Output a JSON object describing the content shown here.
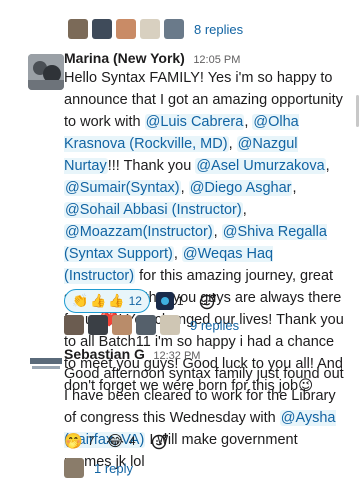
{
  "thread1": {
    "replies_label": "8 replies"
  },
  "message1": {
    "sender": "Marina (New York)",
    "time": "12:05 PM",
    "text_parts": [
      "Hello Syntax FAMILY! Yes i'm so happy to announce that I got an amazing opportunity to work with ",
      "@Luis Cabrera",
      ", ",
      "@Olha Krasnova (Rockville, MD)",
      ", ",
      "@Nazgul Nurtay",
      "!!! Thank you ",
      "@Asel Umurzakova",
      ", ",
      "@Sumair(Syntax)",
      ", ",
      "@Diego Asghar",
      ", ",
      "@Sohail Abbasi (Instructor)",
      ", ",
      "@Moazzam(Instructor)",
      ", ",
      "@Shiva Regalla (Syntax Support)",
      ", ",
      "@Weqas Haq (Instructor)",
      " for this amazing journey, great support and that you guys are always there for us",
      "❤️",
      "! You changed our lives! Thank you to all Batch11 i'm so happy i had a chance to meet you guys! Good luck to you all! And don't forget we were born for this job",
      "😉"
    ],
    "reactions": {
      "clap_count": "12",
      "other_count": "1"
    },
    "replies_label": "9 replies"
  },
  "message2": {
    "sender": "Sebastian G",
    "time": "12:32 PM",
    "text_before": "Good afternoon  syntax family just found out I have been cleared to work for the Library of congress this Wednesday with ",
    "mention": "@Aysha (Fairfax, VA)",
    "text_after": "  I will make government memes  jk lol",
    "reactions": {
      "laugh1_count": "7",
      "laugh2_count": "4"
    },
    "replies_label": "1 reply"
  },
  "colors": {
    "link": "#1264a3",
    "mention_bg": "#e8f5fa",
    "active_pill_border": "#1d9bd1"
  }
}
